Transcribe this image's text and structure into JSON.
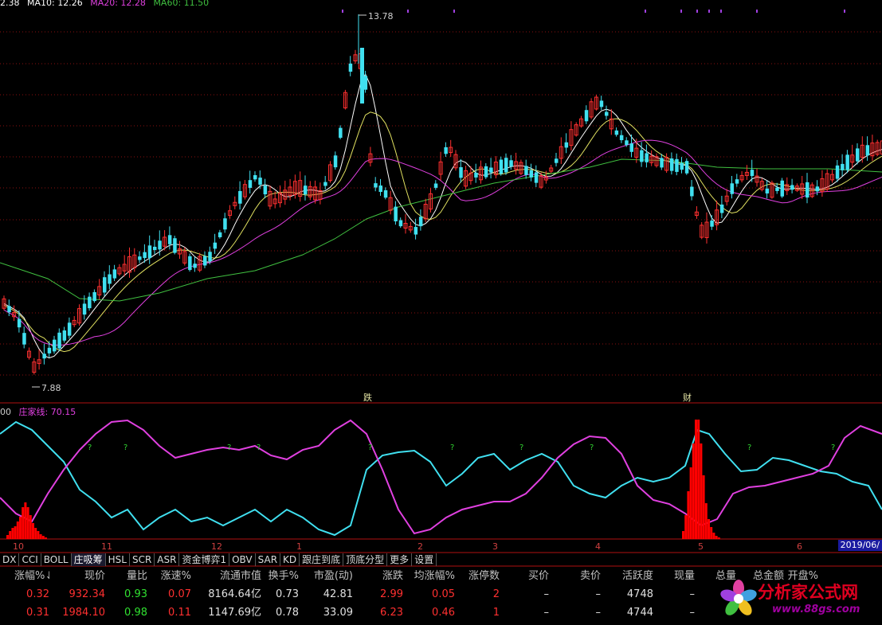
{
  "ma_legend": [
    {
      "label": "2.38",
      "color": "#ffffff"
    },
    {
      "label": "MA10: 12.26",
      "color": "#ffffff"
    },
    {
      "label": "MA20: 12.28",
      "color": "#e040e0"
    },
    {
      "label": "MA60: 11.50",
      "color": "#40c040"
    }
  ],
  "price_annotations": {
    "high": "13.78",
    "low": "7.88"
  },
  "event_markers": {
    "die": "跌",
    "cai": "财"
  },
  "indicator_legend": {
    "prefix": "00",
    "name": "庄家线: 70.15",
    "color": "#e040e0"
  },
  "xaxis_labels": [
    "10",
    "11",
    "12",
    "1",
    "2",
    "3",
    "4",
    "5",
    "6"
  ],
  "date_badge": "2019/06/",
  "question_mark": "?",
  "tabs": [
    "DX",
    "CCI",
    "BOLL",
    "庄吸筹",
    "HSL",
    "SCR",
    "ASR",
    "资金博弈1",
    "OBV",
    "SAR",
    "KD",
    "跟庄到底",
    "顶底分型",
    "更多",
    "设置"
  ],
  "active_tab": "庄吸筹",
  "table": {
    "headers": [
      "",
      "涨幅%↓",
      "现价",
      "量比",
      "涨速%",
      "流通市值",
      "换手%",
      "市盈(动)",
      "涨跌",
      "均涨幅%",
      "涨停数",
      "买价",
      "卖价",
      "活跃度",
      "现量",
      "总量",
      "总金额",
      "开盘%"
    ],
    "rows": [
      [
        "",
        "0.32",
        "932.34",
        "0.93",
        "0.07",
        "8164.64亿",
        "0.73",
        "42.81",
        "2.99",
        "0.05",
        "2",
        "–",
        "–",
        "4748",
        "–",
        "",
        "",
        ""
      ],
      [
        "",
        "0.31",
        "1984.10",
        "0.98",
        "0.11",
        "1147.69亿",
        "0.78",
        "33.09",
        "6.23",
        "0.46",
        "1",
        "–",
        "–",
        "4744",
        "–",
        "",
        "",
        ""
      ]
    ],
    "colors": {
      "up": "#ff3030",
      "ratio": "#30e030",
      "neutral": "#e0e0e0",
      "count": "#ff3030"
    }
  },
  "watermark": {
    "title": "分析家公式网",
    "url": "www.88gs.com"
  },
  "colors": {
    "up_candle": "#ff3030",
    "down_candle": "#40e0f0",
    "ma5": "#ffffff",
    "ma10": "#e0e060",
    "ma20": "#e040e0",
    "ma60": "#40c040",
    "grid": "#8a1010",
    "cyan_line": "#40e0f0",
    "magenta_line": "#e040e0",
    "red_bars": "#ff0000"
  }
}
